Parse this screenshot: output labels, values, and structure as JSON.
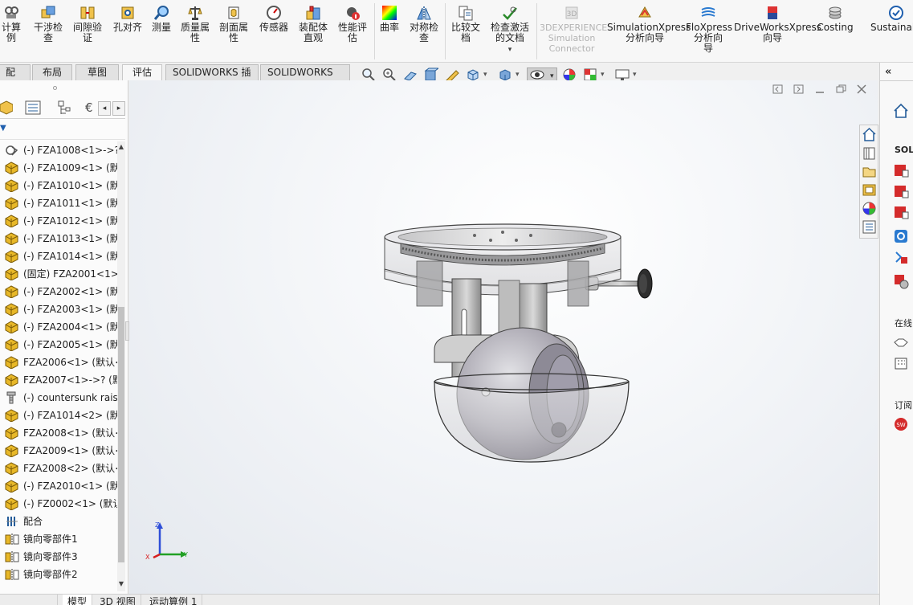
{
  "ribbon": {
    "items": [
      {
        "label": "计算\n例"
      },
      {
        "label": "干涉检\n查"
      },
      {
        "label": "间隙验\n证"
      },
      {
        "label": "孔对齐"
      },
      {
        "label": "测量"
      },
      {
        "label": "质量属\n性"
      },
      {
        "label": "剖面属\n性"
      },
      {
        "label": "传感器"
      },
      {
        "label": "装配体\n直观"
      },
      {
        "label": "性能评\n估"
      },
      {
        "label": "曲率"
      },
      {
        "label": "对称检\n查"
      },
      {
        "label": "比较文\n档"
      },
      {
        "label": "检查激活\n的文档"
      },
      {
        "label": "3DEXPERIENCE\nSimulation\nConnector"
      },
      {
        "label": "SimulationXpress\n分析向导"
      },
      {
        "label": "FloXpress\n分析向\n导"
      },
      {
        "label": "DriveWorksXpress\n向导"
      },
      {
        "label": "Costing"
      },
      {
        "label": "Sustainab"
      }
    ]
  },
  "tabs": [
    {
      "label": "配体"
    },
    {
      "label": "布局"
    },
    {
      "label": "草图"
    },
    {
      "label": "评估"
    },
    {
      "label": "SOLIDWORKS 插件"
    },
    {
      "label": "SOLIDWORKS MBD"
    }
  ],
  "tree": {
    "items": [
      {
        "label": "(-) FZA1008<1>->?",
        "icon": "assembly-icon"
      },
      {
        "label": "(-) FZA1009<1> (默认",
        "icon": "part-icon"
      },
      {
        "label": "(-) FZA1010<1> (默认",
        "icon": "part-icon"
      },
      {
        "label": "(-) FZA1011<1> (默认",
        "icon": "part-icon"
      },
      {
        "label": "(-) FZA1012<1> (默认",
        "icon": "part-icon"
      },
      {
        "label": "(-) FZA1013<1> (默认",
        "icon": "part-icon"
      },
      {
        "label": "(-) FZA1014<1> (默认",
        "icon": "part-icon"
      },
      {
        "label": "(固定) FZA2001<1>",
        "icon": "part-icon"
      },
      {
        "label": "(-) FZA2002<1> (默认",
        "icon": "part-icon"
      },
      {
        "label": "(-) FZA2003<1> (默认",
        "icon": "part-icon"
      },
      {
        "label": "(-) FZA2004<1> (默认",
        "icon": "part-icon"
      },
      {
        "label": "(-) FZA2005<1> (默认",
        "icon": "part-icon"
      },
      {
        "label": "FZA2006<1> (默认<",
        "icon": "part-icon"
      },
      {
        "label": "FZA2007<1>->? (默",
        "icon": "part-icon"
      },
      {
        "label": "(-) countersunk rais",
        "icon": "screw-icon"
      },
      {
        "label": "(-) FZA1014<2> (默认",
        "icon": "part-icon"
      },
      {
        "label": "FZA2008<1> (默认<",
        "icon": "part-icon"
      },
      {
        "label": "FZA2009<1> (默认<",
        "icon": "part-icon"
      },
      {
        "label": "FZA2008<2> (默认<",
        "icon": "part-icon"
      },
      {
        "label": "(-) FZA2010<1> (默认",
        "icon": "part-icon"
      },
      {
        "label": "(-) FZ0002<1> (默认",
        "icon": "part-icon"
      },
      {
        "label": "配合",
        "icon": "mates-icon"
      },
      {
        "label": "镜向零部件1",
        "icon": "mirror-component-icon"
      },
      {
        "label": "镜向零部件3",
        "icon": "mirror-component-icon"
      },
      {
        "label": "镜向零部件2",
        "icon": "mirror-component-icon"
      }
    ]
  },
  "bottom_tabs": [
    {
      "label": "模型"
    },
    {
      "label": "3D 视图"
    },
    {
      "label": "运动算例 1"
    }
  ],
  "triad": {
    "x": "X",
    "y": "Y",
    "z": "Z"
  },
  "taskpane": {
    "labels": [
      "SOLI",
      "在线",
      "订阅"
    ]
  },
  "colors": {
    "accent": "#1f5fae",
    "part_yellow": "#e8b828",
    "sw_red": "#d42b2b"
  }
}
